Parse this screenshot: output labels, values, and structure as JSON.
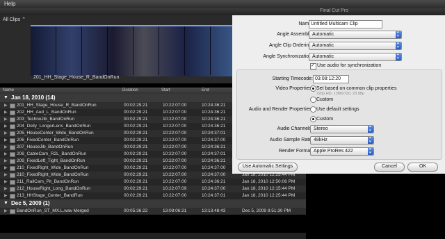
{
  "menubar": {
    "help": "Help"
  },
  "window": {
    "title": "Final Cut Pro"
  },
  "browser": {
    "clips_selector": "All Clips",
    "filmstrip_label": "201_HH_Stage_House_R_BandOnRun",
    "columns": {
      "name": "Name",
      "duration": "Duration",
      "start": "Start",
      "end": "End"
    },
    "groups": [
      {
        "title": "Jan 18, 2010  (14)",
        "rows": [
          [
            "201_HH_Stage_House_R_BandOnRun",
            "00:02:29:21",
            "10:22:07:00",
            "10:24:36:21",
            ""
          ],
          [
            "202_HH_Aud_L_BandOnRun",
            "00:02:29:21",
            "10:22:07:00",
            "10:24:36:21",
            ""
          ],
          [
            "203_TechnoJib_BandOnRun",
            "00:02:29:21",
            "10:22:07:00",
            "10:24:36:21",
            ""
          ],
          [
            "204_Dolly_LongerLens_BandOnRun",
            "00:02:29:21",
            "10:22:07:00",
            "10:24:36:21",
            ""
          ],
          [
            "205_HouseCenter_Wide_BandOnRun",
            "00:02:29:21",
            "10:22:07:00",
            "10:24:37:01",
            ""
          ],
          [
            "206_FixedCenter_BandOnRun",
            "00:02:29:21",
            "10:22:07:00",
            "10:24:37:00",
            ""
          ],
          [
            "207_HouseJib_BandOnRun",
            "00:02:29:21",
            "10:22:07:00",
            "10:24:36:21",
            ""
          ],
          [
            "208_CableCam_R2L_BandOnRun",
            "00:02:29:21",
            "10:22:07:00",
            "10:24:37:01",
            ""
          ],
          [
            "209_FixedLeft_Tight_BandOnRun",
            "00:02:29:21",
            "10:22:07:00",
            "10:24:36:21",
            ""
          ],
          [
            "210_FixedRight_Wide_BandOnRun",
            "00:02:29:21",
            "10:22:07:00",
            "10:24:37:00",
            "Jan 18, 2010 12:25:44 PM"
          ],
          [
            "210_FixedRight_Wide_BandOnRun",
            "00:02:29:21",
            "10:22:07:00",
            "10:24:37:00",
            "Jan 18, 2010 12:25:44 PM"
          ],
          [
            "211_RailCam_Pit_BandOnRun",
            "00:02:29:21",
            "10:22:07:00",
            "10:24:36:21",
            "Jan 18, 2010 12:50:06 PM"
          ],
          [
            "212_HouseRight_Long_BandOnRun",
            "00:02:29:21",
            "10:22:07:09",
            "10:24:37:00",
            "Jan 18, 2010 12:15:44 PM"
          ],
          [
            "213_HHStage_Center_BandRun",
            "00:02:29:21",
            "10:22:07:00",
            "10:24:37:01",
            "Jan 18, 2010 12:25:44 PM"
          ]
        ]
      },
      {
        "title": "Dec 5, 2009  (1)",
        "rows": [
          [
            "BandOnRun_ST_MX.L.wav Merged",
            "00:05:36:22",
            "13:08:06:21",
            "13:13:48:43",
            "Dec 5, 2009 8:51:30 PM"
          ]
        ]
      }
    ]
  },
  "dialog": {
    "name_label": "Name:",
    "name_value": "Untitled Multicam Clip",
    "angle_assembly_label": "Angle Assembly:",
    "angle_assembly_value": "Automatic",
    "angle_clip_ordering_label": "Angle Clip Ordering:",
    "angle_clip_ordering_value": "Automatic",
    "angle_sync_label": "Angle Synchronization:",
    "angle_sync_value": "Automatic",
    "use_audio_sync": "Use audio for synchronization",
    "starting_tc_label": "Starting Timecode:",
    "starting_tc_value": "03:08:12:20",
    "video_props_label": "Video Properties:",
    "video_opt1": "Set based on common clip properties",
    "video_opt1_detail": "720p HD, 1280x720, 23.98p",
    "video_opt2": "Custom",
    "audio_render_label": "Audio and Render Properties:",
    "audio_opt1": "Use default settings",
    "audio_opt2": "Custom",
    "audio_channels_label": "Audio Channels:",
    "audio_channels_value": "Stereo",
    "audio_rate_label": "Audio Sample Rate:",
    "audio_rate_value": "48kHz",
    "render_format_label": "Render Format:",
    "render_format_value": "Apple ProRes 422",
    "auto_settings_button": "Use Automatic Settings",
    "cancel_button": "Cancel",
    "ok_button": "OK"
  }
}
